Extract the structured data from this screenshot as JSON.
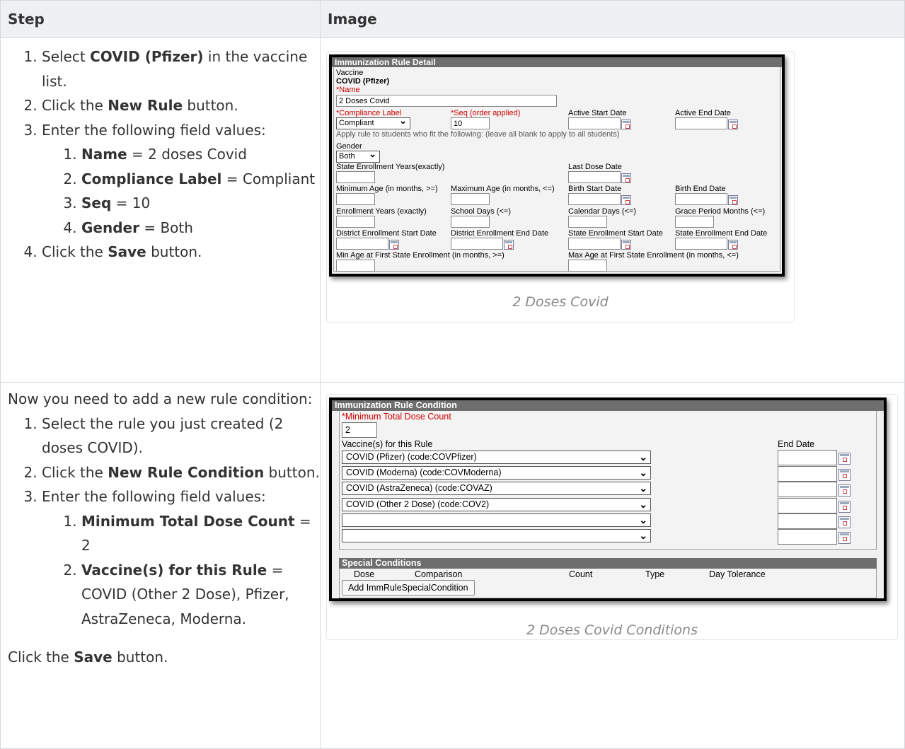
{
  "table": {
    "col_step": "Step",
    "col_image": "Image"
  },
  "row1": {
    "steps": {
      "s1_pre": "Select ",
      "s1_bold": "COVID (Pfizer)",
      "s1_post": " in the vaccine list.",
      "s2_pre": "Click the ",
      "s2_bold": "New Rule",
      "s2_post": " button.",
      "s3": "Enter the following field values:",
      "sub1_bold": "Name",
      "sub1_val": " = 2 doses Covid",
      "sub2_bold": "Compliance Label",
      "sub2_val": " = Compliant",
      "sub3_bold": "Seq",
      "sub3_val": " = 10",
      "sub4_bold": "Gender",
      "sub4_val": " = Both",
      "s4_pre": "Click the ",
      "s4_bold": "Save",
      "s4_post": " button."
    },
    "caption": "2 Doses Covid",
    "shot": {
      "header": "Immunization Rule Detail",
      "vaccine_label": "Vaccine",
      "vaccine_value": "COVID (Pfizer)",
      "name_label": "*Name",
      "name_value": "2 Doses Covid",
      "compliance_label": "*Compliance Label",
      "compliance_value": "Compliant",
      "seq_label": "*Seq (order applied)",
      "seq_value": "10",
      "active_start": "Active Start Date",
      "active_end": "Active End Date",
      "apply_note": "Apply rule to students who fit the following: (leave all blank to apply to all students)",
      "gender_label": "Gender",
      "gender_value": "Both",
      "state_enroll_years": "State Enrollment Years(exactly)",
      "last_dose_date": "Last Dose Date",
      "min_age": "Minimum Age (in months, >=)",
      "max_age": "Maximum Age (in months, <=)",
      "birth_start": "Birth Start Date",
      "birth_end": "Birth End Date",
      "enroll_years": "Enrollment Years (exactly)",
      "school_days": "School Days (<=)",
      "calendar_days": "Calendar Days (<=)",
      "grace_period": "Grace Period Months (<=)",
      "district_start": "District Enrollment Start Date",
      "district_end": "District Enrollment End Date",
      "state_start": "State Enrollment Start Date",
      "state_end": "State Enrollment End Date",
      "min_age_first": "Min Age at First State Enrollment (in months, >=)",
      "max_age_first": "Max Age at First State Enrollment (in months, <=)"
    }
  },
  "row2": {
    "steps": {
      "intro": "Now you need to add a new rule condition:",
      "s1": "Select the rule you just created (2 doses COVID).",
      "s2_pre": "Click the ",
      "s2_bold": "New Rule Condition",
      "s2_post": " button.",
      "s3": "Enter the following field values:",
      "sub1_bold": "Minimum Total Dose Count",
      "sub1_val": " = 2",
      "sub2_bold": "Vaccine(s) for this Rule",
      "sub2_val": " = COVID (Other 2 Dose), Pfizer, AstraZeneca, Moderna.",
      "final_pre": "Click the ",
      "final_bold": "Save",
      "final_post": " button."
    },
    "caption": "2 Doses Covid Conditions",
    "shot": {
      "header": "Immunization Rule Condition",
      "min_dose_label": "*Minimum Total Dose Count",
      "min_dose_value": "2",
      "vaccines_label": "Vaccine(s) for this Rule",
      "end_date_label": "End Date",
      "vaccines": [
        "COVID (Pfizer) (code:COVPfizer)",
        "COVID (Moderna) (code:COVModerna)",
        "COVID (AstraZeneca) (code:COVAZ)",
        "COVID (Other 2 Dose) (code:COV2)",
        "",
        ""
      ],
      "special_header": "Special Conditions",
      "col_dose": "Dose",
      "col_comparison": "Comparison",
      "col_count": "Count",
      "col_type": "Type",
      "col_tolerance": "Day Tolerance",
      "add_button": "Add ImmRuleSpecialCondition"
    }
  }
}
